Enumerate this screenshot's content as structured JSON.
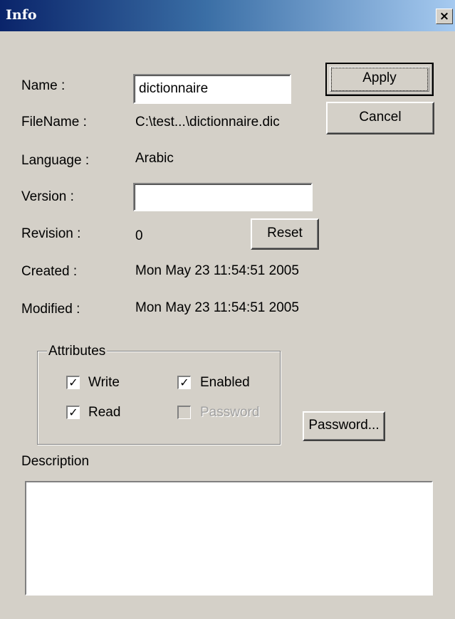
{
  "window": {
    "title": "Info",
    "close_glyph": "×"
  },
  "fields": {
    "name_label": "Name :",
    "name_value": "dictionnaire",
    "filename_label": "FileName :",
    "filename_value": "C:\\test...\\dictionnaire.dic",
    "language_label": "Language :",
    "language_value": "Arabic",
    "version_label": "Version :",
    "version_value": "",
    "revision_label": "Revision :",
    "revision_value": "0",
    "created_label": "Created :",
    "created_value": "Mon May 23 11:54:51 2005",
    "modified_label": "Modified :",
    "modified_value": "Mon May 23 11:54:51 2005"
  },
  "buttons": {
    "apply": "Apply",
    "cancel": "Cancel",
    "reset": "Reset",
    "password": "Password..."
  },
  "attributes": {
    "legend": "Attributes",
    "write": {
      "label": "Write",
      "checked": true,
      "mark": "✓"
    },
    "enabled": {
      "label": "Enabled",
      "checked": true,
      "mark": "✓"
    },
    "read": {
      "label": "Read",
      "checked": true,
      "mark": "✓"
    },
    "password": {
      "label": "Password",
      "checked": false,
      "disabled": true,
      "mark": ""
    }
  },
  "description": {
    "label": "Description",
    "value": ""
  }
}
